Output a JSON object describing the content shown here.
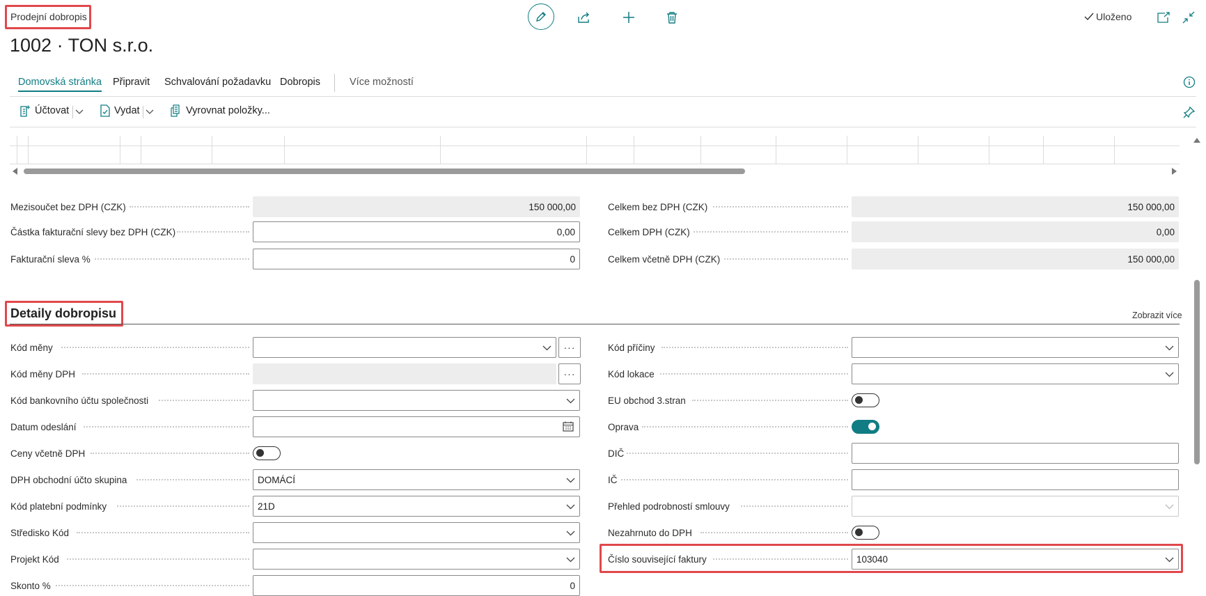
{
  "header": {
    "page_type": "Prodejní dobropis",
    "title": "1002 · TON s.r.o.",
    "saved_label": "Uloženo"
  },
  "tabs": [
    {
      "label": "Domovská stránka"
    },
    {
      "label": "Připravit"
    },
    {
      "label": "Schvalování požadavku"
    },
    {
      "label": "Dobropis"
    },
    {
      "label": "Více možností"
    }
  ],
  "actions": {
    "post_label": "Účtovat",
    "issue_label": "Vydat",
    "apply_label": "Vyrovnat položky..."
  },
  "totals": {
    "subtotal_label": "Mezisoučet bez DPH (CZK)",
    "subtotal_value": "150 000,00",
    "inv_discount_amount_label": "Částka fakturační slevy bez DPH (CZK)",
    "inv_discount_amount_value": "0,00",
    "inv_discount_pct_label": "Fakturační sleva %",
    "inv_discount_pct_value": "0",
    "total_excl_label": "Celkem bez DPH (CZK)",
    "total_excl_value": "150 000,00",
    "total_vat_label": "Celkem DPH (CZK)",
    "total_vat_value": "0,00",
    "total_incl_label": "Celkem včetně DPH (CZK)",
    "total_incl_value": "150 000,00"
  },
  "details": {
    "section_title": "Detaily dobropisu",
    "show_more": "Zobrazit více",
    "left": [
      {
        "label": "Kód měny",
        "value": ""
      },
      {
        "label": "Kód měny DPH",
        "value": ""
      },
      {
        "label": "Kód bankovního účtu společnosti",
        "value": ""
      },
      {
        "label": "Datum odeslání",
        "value": ""
      },
      {
        "label": "Ceny včetně DPH",
        "value": "off"
      },
      {
        "label": "DPH obchodní účto skupina",
        "value": "DOMÁCÍ"
      },
      {
        "label": "Kód platební podmínky",
        "value": "21D"
      },
      {
        "label": "Středisko Kód",
        "value": ""
      },
      {
        "label": "Projekt Kód",
        "value": ""
      },
      {
        "label": "Skonto %",
        "value": "0"
      }
    ],
    "right": [
      {
        "label": "Kód příčiny",
        "value": ""
      },
      {
        "label": "Kód lokace",
        "value": ""
      },
      {
        "label": "EU obchod 3.stran",
        "value": "off"
      },
      {
        "label": "Oprava",
        "value": "on"
      },
      {
        "label": "DIČ",
        "value": ""
      },
      {
        "label": "IČ",
        "value": ""
      },
      {
        "label": "Přehled podrobností smlouvy",
        "value": ""
      },
      {
        "label": "Nezahrnuto do DPH",
        "value": "off"
      },
      {
        "label": "Číslo související faktury",
        "value": "103040"
      }
    ]
  },
  "colors": {
    "accent": "#117c83",
    "highlight": "#e0484c"
  }
}
